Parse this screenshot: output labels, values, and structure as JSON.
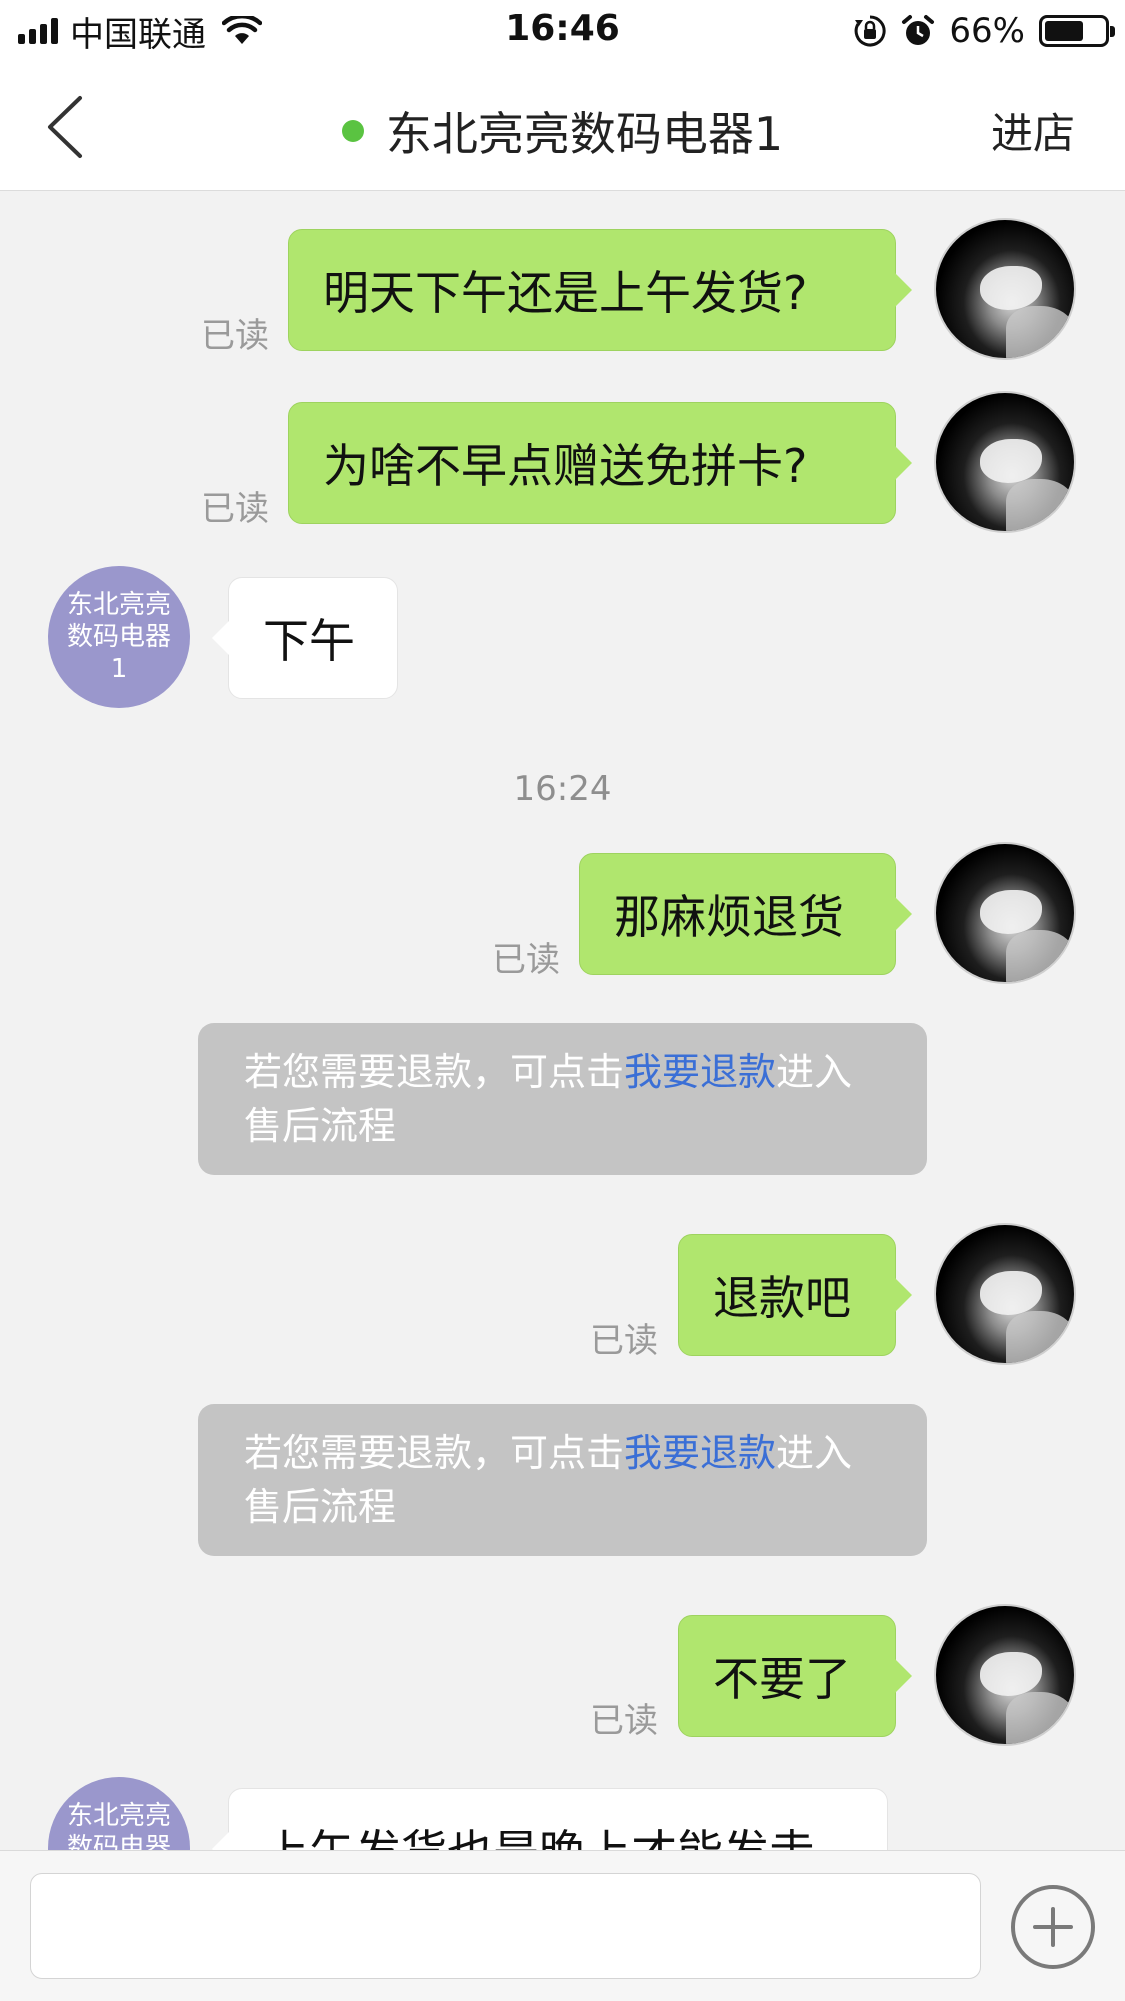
{
  "status_bar": {
    "carrier": "中国联通",
    "time": "16:46",
    "battery_percent": "66%",
    "battery_level": 0.66,
    "icons": [
      "signal-icon",
      "wifi-icon",
      "rotation-lock-icon",
      "alarm-icon",
      "battery-icon"
    ]
  },
  "header": {
    "title": "东北亮亮数码电器1",
    "online_status_color": "#5ac341",
    "right_action": "进店"
  },
  "shop": {
    "avatar_text": "东北亮亮数码电器1"
  },
  "messages": [
    {
      "sender": "me",
      "text": "明天下午还是上午发货?",
      "read": "已读"
    },
    {
      "sender": "me",
      "text": "为啥不早点赠送免拼卡?",
      "read": "已读"
    },
    {
      "sender": "shop",
      "text": "下午"
    },
    {
      "type": "timestamp",
      "text": "16:24"
    },
    {
      "sender": "me",
      "text": "那麻烦退货",
      "read": "已读"
    },
    {
      "type": "notice",
      "prefix": "若您需要退款，可点击",
      "link": "我要退款",
      "suffix": "进入售后流程"
    },
    {
      "sender": "me",
      "text": "退款吧",
      "read": "已读"
    },
    {
      "type": "notice",
      "prefix": "若您需要退款，可点击",
      "link": "我要退款",
      "suffix": "进入售后流程"
    },
    {
      "sender": "me",
      "text": "不要了",
      "read": "已读"
    },
    {
      "sender": "shop",
      "text": "上午发货也是晚上才能发走"
    }
  ],
  "input": {
    "value": "",
    "placeholder": ""
  },
  "colors": {
    "my_bubble": "#b0e66e",
    "shop_avatar": "#9a97cc",
    "link": "#3b6fd6",
    "notice_bg": "#c4c4c4"
  }
}
